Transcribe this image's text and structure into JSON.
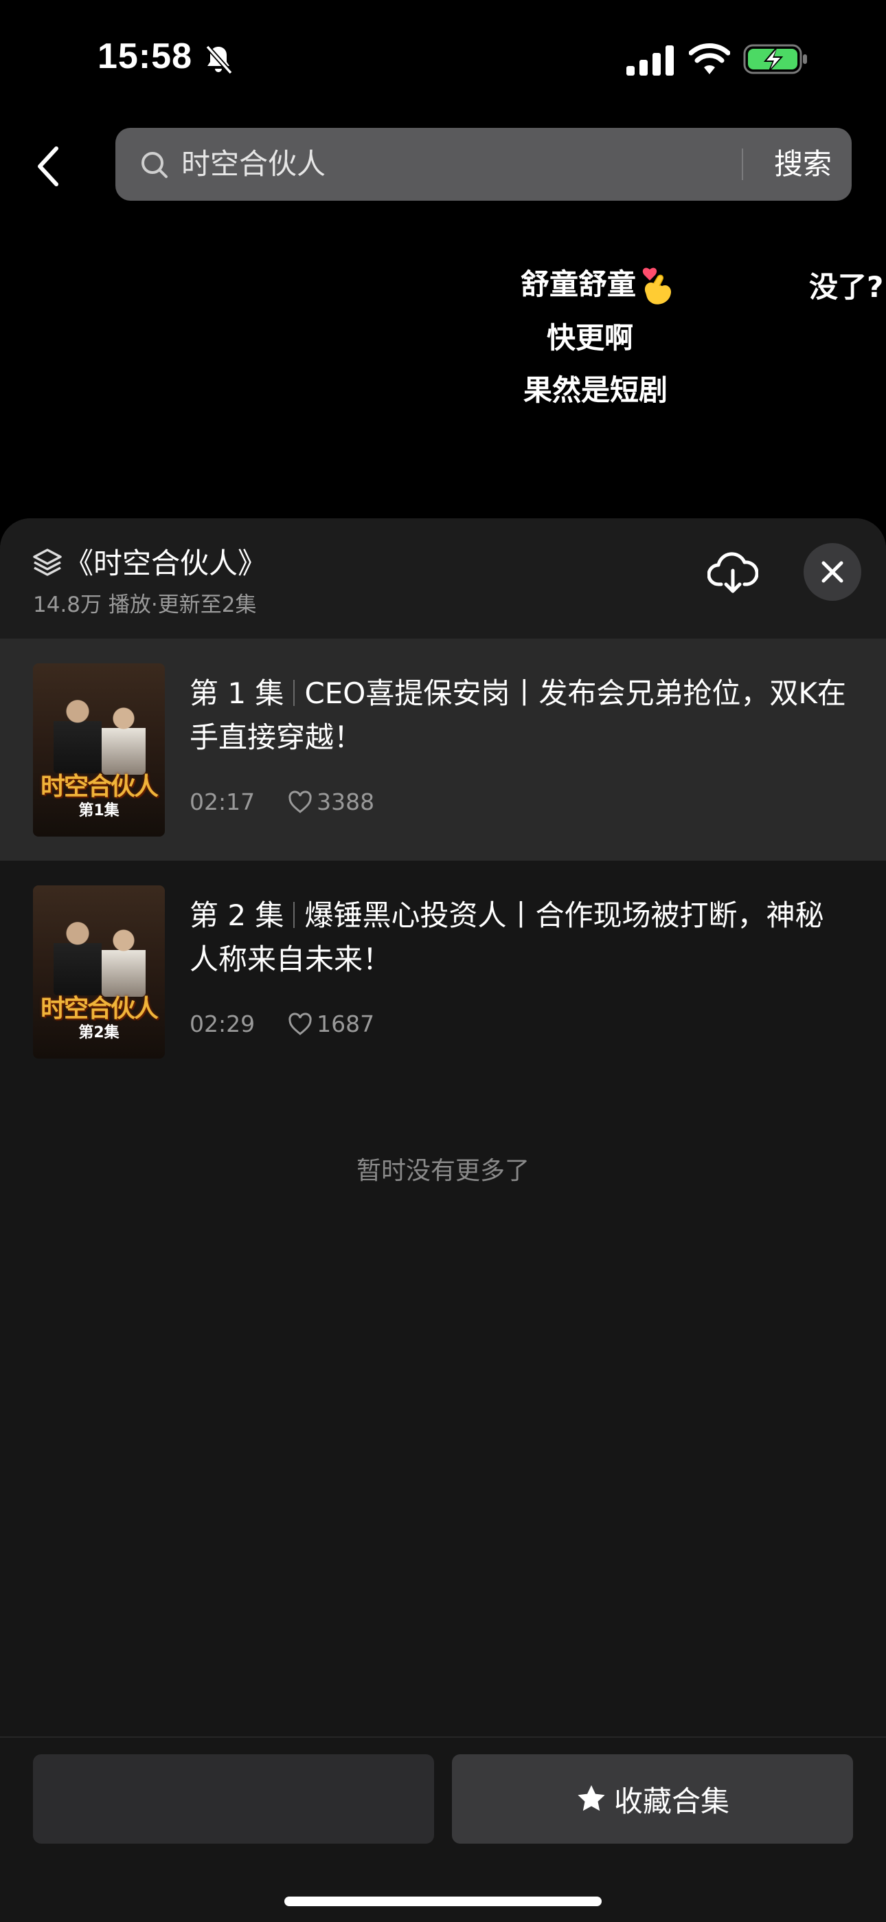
{
  "status_bar": {
    "time": "15:58"
  },
  "search": {
    "query": "时空合伙人",
    "button_label": "搜索"
  },
  "danmaku": {
    "items": [
      "舒童舒童",
      "没了?",
      "快更啊",
      "果然是短剧"
    ]
  },
  "collection": {
    "title": "《时空合伙人》",
    "subtitle": "14.8万 播放·更新至2集",
    "thumb_title": "时空合伙人",
    "episodes": [
      {
        "number": "第 1 集",
        "title": "CEO喜提保安岗丨发布会兄弟抢位，双K在手直接穿越！",
        "thumb_label": "第1集",
        "duration": "02:17",
        "likes": "3388"
      },
      {
        "number": "第 2 集",
        "title": "爆锤黑心投资人丨合作现场被打断，神秘人称来自未来！",
        "thumb_label": "第2集",
        "duration": "02:29",
        "likes": "1687"
      }
    ],
    "no_more_text": "暂时没有更多了"
  },
  "bottom": {
    "favorite_label": "收藏合集"
  },
  "colors": {
    "sheet_background": "#161616",
    "active_row": "#2a2a2a",
    "search_bar": "#5a5a5c",
    "battery_green": "#4cd964"
  }
}
